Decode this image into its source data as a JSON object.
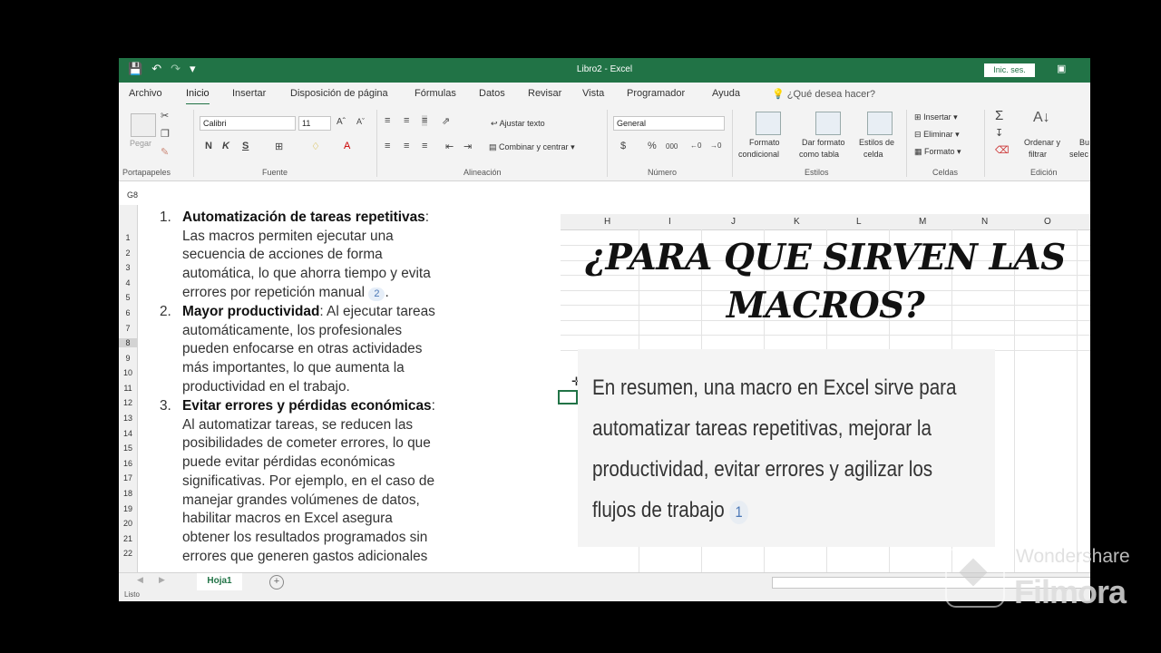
{
  "window": {
    "title": "Libro2 - Excel",
    "signin_label": "Inic. ses."
  },
  "ribbon_tabs": [
    "Archivo",
    "Inicio",
    "Insertar",
    "Disposición de página",
    "Fórmulas",
    "Datos",
    "Revisar",
    "Vista",
    "Programador",
    "Ayuda"
  ],
  "tell_me": "¿Qué desea hacer?",
  "ribbon": {
    "clipboard": {
      "paste": "Pegar",
      "label": "Portapapeles"
    },
    "font": {
      "name": "Calibri",
      "size": "11",
      "bold": "N",
      "italic": "K",
      "underline": "S",
      "label": "Fuente"
    },
    "alignment": {
      "wrap": "Ajustar texto",
      "merge": "Combinar y centrar",
      "label": "Alineación"
    },
    "number": {
      "format": "General",
      "currency": "$",
      "percent": "%",
      "thousands": "000",
      "label": "Número"
    },
    "styles": {
      "conditional_1": "Formato",
      "conditional_2": "condicional",
      "table_1": "Dar formato",
      "table_2": "como tabla",
      "cell_1": "Estilos de",
      "cell_2": "celda",
      "label": "Estilos"
    },
    "cells": {
      "insert": "Insertar",
      "delete": "Eliminar",
      "format": "Formato",
      "label": "Celdas"
    },
    "editing": {
      "sort_1": "Ordenar y",
      "sort_2": "filtrar",
      "find_1": "Bu",
      "find_2": "selec",
      "label": "Edición"
    }
  },
  "name_box": "G8",
  "row_numbers": [
    "1",
    "2",
    "3",
    "4",
    "5",
    "6",
    "7",
    "8",
    "9",
    "10",
    "11",
    "12",
    "13",
    "14",
    "15",
    "16",
    "17",
    "18",
    "19",
    "20",
    "21",
    "22"
  ],
  "column_headers": [
    "H",
    "I",
    "J",
    "K",
    "L",
    "M",
    "N",
    "O"
  ],
  "list": [
    {
      "number": "1.",
      "title": "Automatización de tareas repetitivas",
      "body_lines": [
        "Las macros permiten ejecutar una",
        "secuencia de acciones de forma",
        "automática, lo que ahorra tiempo y evita"
      ],
      "last_line": "errores por repetición manual",
      "citation": "2"
    },
    {
      "number": "2.",
      "title": "Mayor productividad",
      "title_rest": ": Al ejecutar tareas",
      "body_lines": [
        "automáticamente, los profesionales",
        "pueden enfocarse en otras actividades",
        "más importantes, lo que aumenta la",
        "productividad en el trabajo."
      ]
    },
    {
      "number": "3.",
      "title": "Evitar errores y pérdidas económicas",
      "body_lines": [
        "Al automatizar tareas, se reducen las",
        "posibilidades de cometer errores, lo que",
        "puede evitar pérdidas económicas",
        "significativas. Por ejemplo, en el caso de",
        "manejar grandes volúmenes de datos,",
        "habilitar macros en Excel asegura",
        "obtener los resultados programados sin",
        "errores que generen gastos adicionales"
      ]
    }
  ],
  "heading": {
    "line1": "¿PARA QUE SIRVEN LAS",
    "line2": "MACROS?"
  },
  "summary": {
    "lines": [
      "En resumen, una macro en Excel sirve para",
      "automatizar tareas repetitivas, mejorar la",
      "productividad, evitar errores y agilizar los",
      "flujos de trabajo"
    ],
    "citation": "1"
  },
  "sheet_tab": "Hoja1",
  "status_text": "Listo",
  "watermark": {
    "line1": "Wondershare",
    "line2": "Filmora"
  },
  "colors": {
    "excel_green": "#217346"
  }
}
